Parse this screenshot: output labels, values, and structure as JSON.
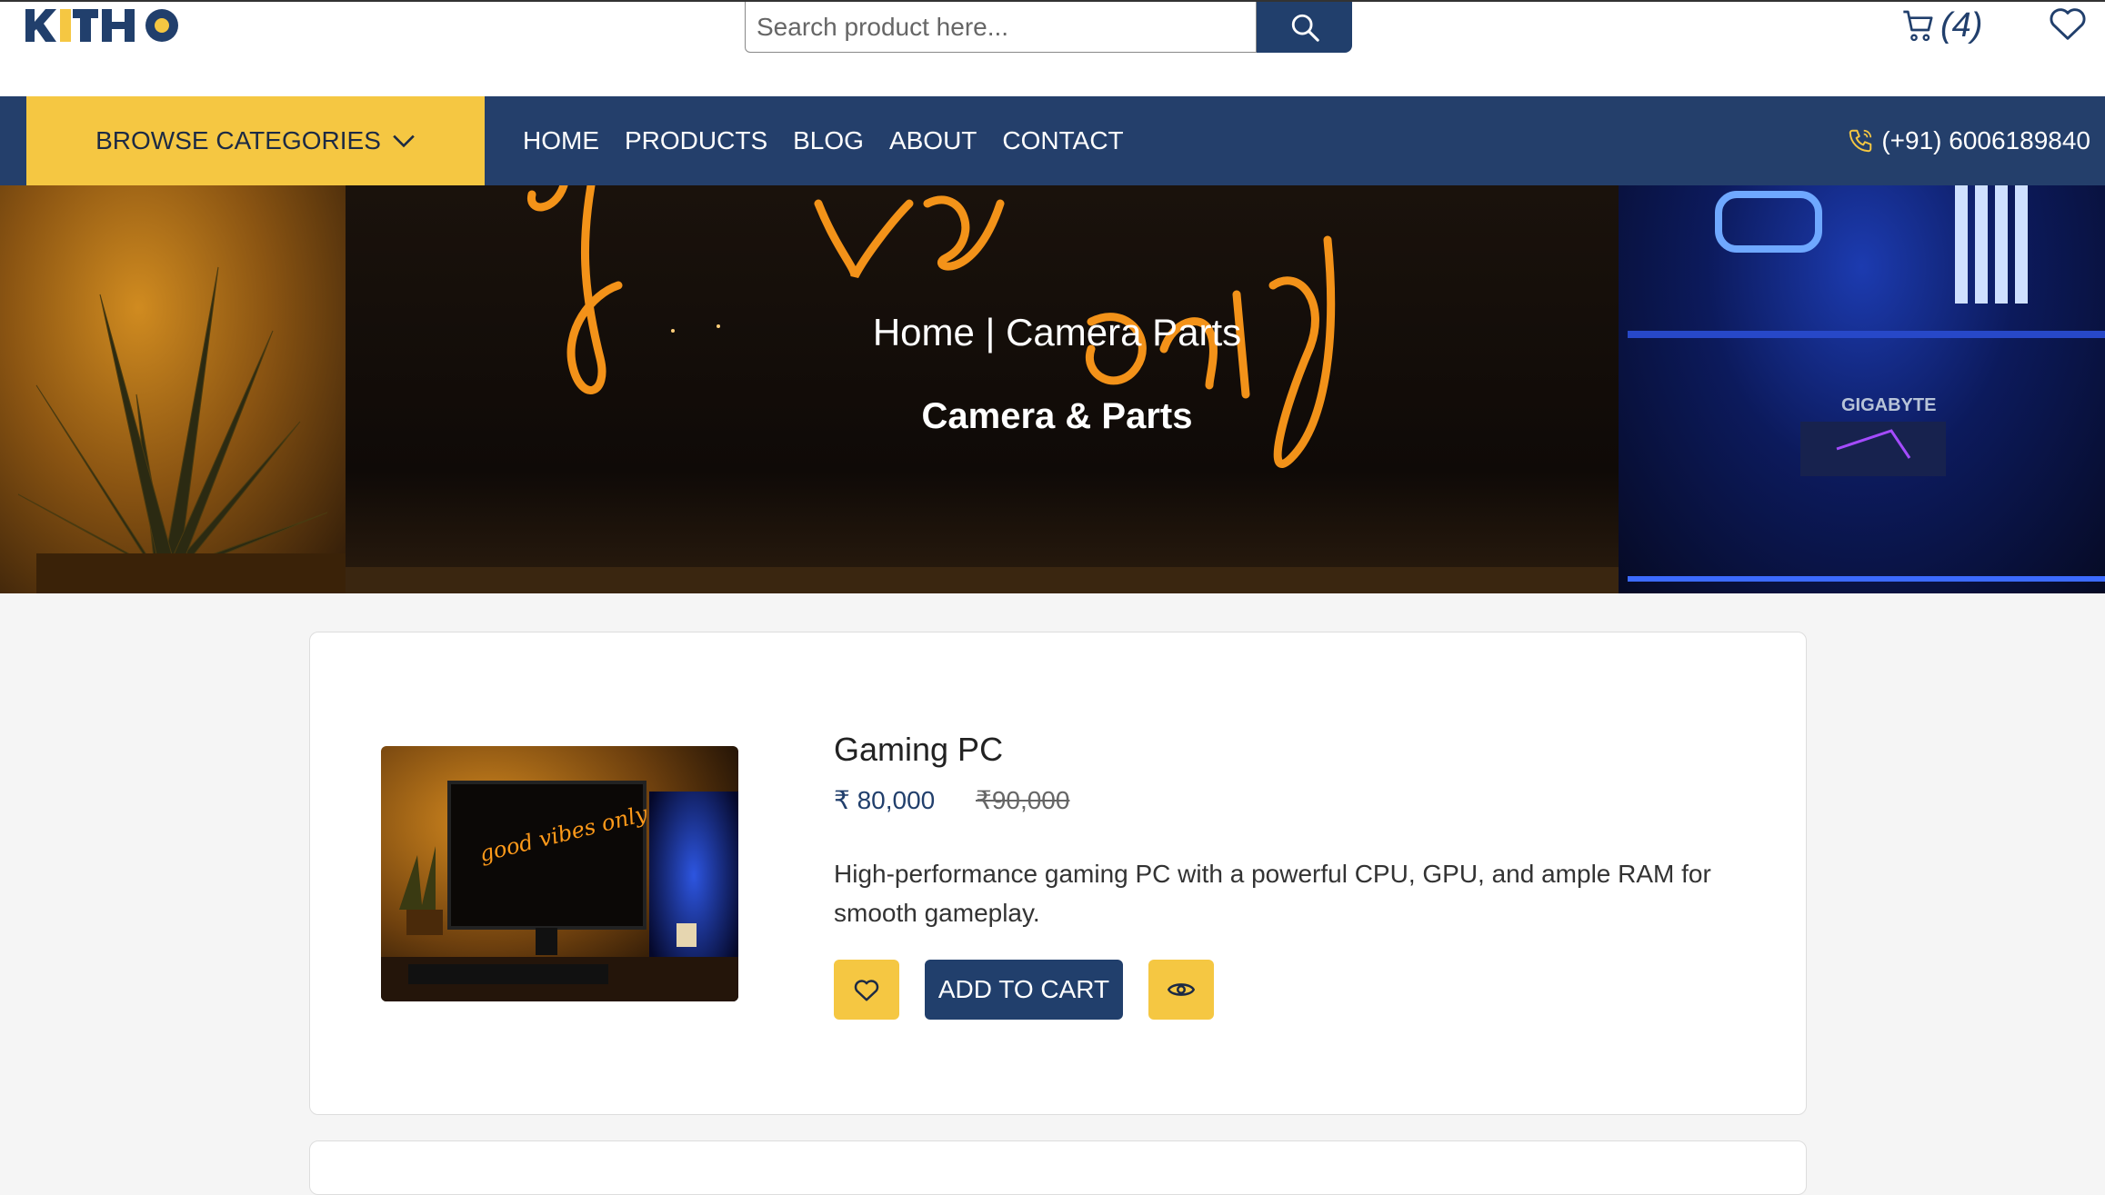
{
  "header": {
    "logo_alt": "KITHO",
    "search_placeholder": "Search product here...",
    "cart_count": "(4)"
  },
  "nav": {
    "browse_label": "BROWSE CATEGORIES",
    "links": [
      "HOME",
      "PRODUCTS",
      "BLOG",
      "ABOUT",
      "CONTACT"
    ],
    "phone": "(+91) 6006189840"
  },
  "hero": {
    "breadcrumb": "Home | Camera Parts",
    "title": "Camera & Parts"
  },
  "product": {
    "name": "Gaming PC",
    "price": "₹ 80,000",
    "old_price": "₹90,000",
    "description": "High-performance gaming PC with a powerful CPU, GPU, and ample RAM for smooth gameplay.",
    "add_to_cart_label": "ADD TO CART",
    "image_text": "good vibes only"
  },
  "colors": {
    "primary": "#213f6c",
    "accent": "#f5c742"
  }
}
